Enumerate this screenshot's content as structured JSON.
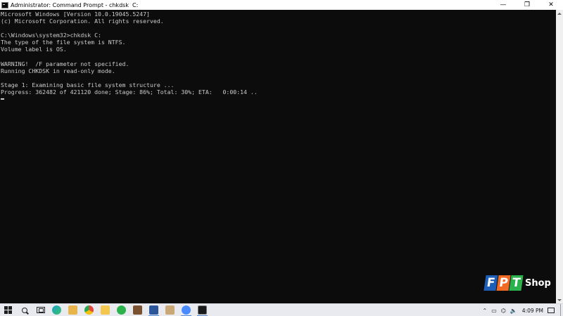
{
  "window": {
    "title": "Administrator: Command Prompt - chkdsk  C:",
    "minimize_glyph": "—",
    "maximize_glyph": "❐",
    "close_glyph": "✕"
  },
  "console": {
    "lines": [
      "Microsoft Windows [Version 10.0.19045.5247]",
      "(c) Microsoft Corporation. All rights reserved.",
      "",
      "C:\\Windows\\system32>chkdsk C:",
      "The type of the file system is NTFS.",
      "Volume label is OS.",
      "",
      "WARNING!  /F parameter not specified.",
      "Running CHKDSK in read-only mode.",
      "",
      "Stage 1: Examining basic file system structure ...",
      "Progress: 362482 of 421120 done; Stage: 86%; Total: 30%; ETA:   0:00:14 .."
    ],
    "text_color": "#cccccc",
    "background": "#0c0c0c"
  },
  "watermark": {
    "letters": [
      "F",
      "P",
      "T"
    ],
    "letter_colors": [
      "#1d5fb8",
      "#f06a23",
      "#2bb24c"
    ],
    "suffix": "Shop"
  },
  "taskbar": {
    "apps": [
      {
        "icon": "task-view-icon"
      },
      {
        "icon": "edge-icon",
        "color": "#1fa0c9"
      },
      {
        "icon": "file-explorer-icon",
        "color": "#e8b54a"
      },
      {
        "icon": "chrome-icon",
        "color": "#e2453c"
      },
      {
        "icon": "file-folder-icon",
        "color": "#f3c64d"
      },
      {
        "icon": "whatsapp-icon",
        "color": "#2bb24c"
      },
      {
        "icon": "archive-icon",
        "color": "#7a5230"
      },
      {
        "icon": "word-icon",
        "color": "#2b579a"
      },
      {
        "icon": "image-viewer-icon",
        "color": "#c9a876"
      },
      {
        "icon": "zoom-icon",
        "color": "#4a8cff"
      },
      {
        "icon": "command-prompt-icon",
        "color": "#1a1a1a"
      }
    ],
    "time": "4:09 PM"
  }
}
